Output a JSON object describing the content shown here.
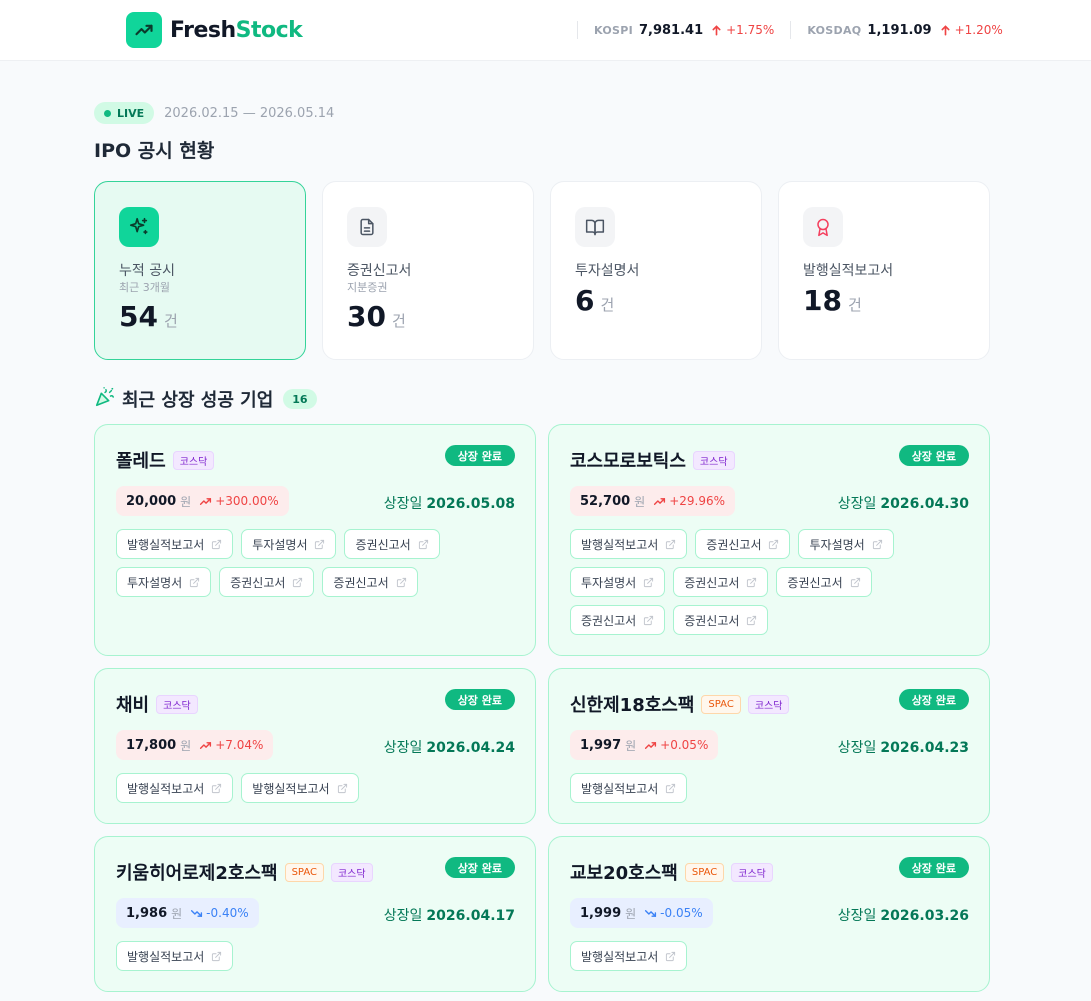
{
  "brand": {
    "fresh": "Fresh",
    "stock": "Stock"
  },
  "tickers": [
    {
      "name": "KOSPI",
      "value": "7,981.41",
      "change": "+1.75%"
    },
    {
      "name": "KOSDAQ",
      "value": "1,191.09",
      "change": "+1.20%"
    }
  ],
  "period": {
    "live_label": "LIVE",
    "range": "2026.02.15 — 2026.05.14"
  },
  "page_title": "IPO 공시 현황",
  "stats": [
    {
      "label": "누적 공시",
      "sub": "최근 3개월",
      "value": "54",
      "unit": "건",
      "icon": "sparkles-icon"
    },
    {
      "label": "증권신고서",
      "sub": "지분증권",
      "value": "30",
      "unit": "건",
      "icon": "document-icon"
    },
    {
      "label": "투자설명서",
      "sub": "",
      "value": "6",
      "unit": "건",
      "icon": "book-icon"
    },
    {
      "label": "발행실적보고서",
      "sub": "",
      "value": "18",
      "unit": "건",
      "icon": "award-icon"
    }
  ],
  "recent": {
    "title": "최근 상장 성공 기업",
    "count": "16"
  },
  "companies": [
    {
      "name": "폴레드",
      "tags": [
        "코스닥"
      ],
      "status": "상장 완료",
      "price": "20,000",
      "unit": "원",
      "change": "+300.00%",
      "direction": "up",
      "listing_label": "상장일",
      "listing_date": "2026.05.08",
      "docs": [
        "발행실적보고서",
        "투자설명서",
        "증권신고서",
        "투자설명서",
        "증권신고서",
        "증권신고서"
      ]
    },
    {
      "name": "코스모로보틱스",
      "tags": [
        "코스닥"
      ],
      "status": "상장 완료",
      "price": "52,700",
      "unit": "원",
      "change": "+29.96%",
      "direction": "up",
      "listing_label": "상장일",
      "listing_date": "2026.04.30",
      "docs": [
        "발행실적보고서",
        "증권신고서",
        "투자설명서",
        "투자설명서",
        "증권신고서",
        "증권신고서",
        "증권신고서",
        "증권신고서"
      ]
    },
    {
      "name": "채비",
      "tags": [
        "코스닥"
      ],
      "status": "상장 완료",
      "price": "17,800",
      "unit": "원",
      "change": "+7.04%",
      "direction": "up",
      "listing_label": "상장일",
      "listing_date": "2026.04.24",
      "docs": [
        "발행실적보고서",
        "발행실적보고서"
      ]
    },
    {
      "name": "신한제18호스팩",
      "tags": [
        "SPAC",
        "코스닥"
      ],
      "status": "상장 완료",
      "price": "1,997",
      "unit": "원",
      "change": "+0.05%",
      "direction": "up",
      "listing_label": "상장일",
      "listing_date": "2026.04.23",
      "docs": [
        "발행실적보고서"
      ]
    },
    {
      "name": "키움히어로제2호스팩",
      "tags": [
        "SPAC",
        "코스닥"
      ],
      "status": "상장 완료",
      "price": "1,986",
      "unit": "원",
      "change": "-0.40%",
      "direction": "down",
      "listing_label": "상장일",
      "listing_date": "2026.04.17",
      "docs": [
        "발행실적보고서"
      ]
    },
    {
      "name": "교보20호스팩",
      "tags": [
        "SPAC",
        "코스닥"
      ],
      "status": "상장 완료",
      "price": "1,999",
      "unit": "원",
      "change": "-0.05%",
      "direction": "down",
      "listing_label": "상장일",
      "listing_date": "2026.03.26",
      "docs": [
        "발행실적보고서"
      ]
    }
  ],
  "colors": {
    "accent": "#10d59a",
    "brand_green": "#10b981",
    "up": "#ef4444",
    "down": "#3b82f6",
    "card_bg": "#edfdf5"
  }
}
